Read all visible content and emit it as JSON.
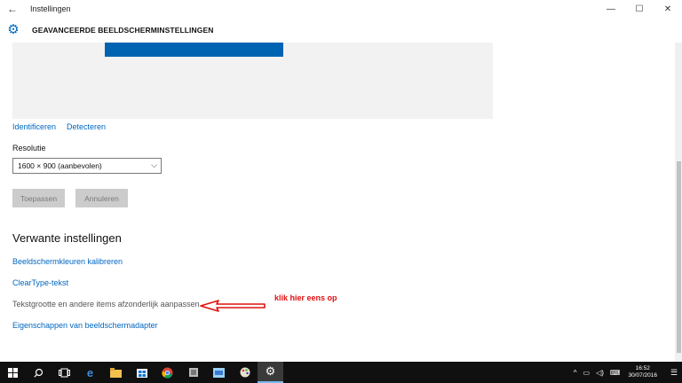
{
  "window": {
    "app_title": "Instellingen",
    "back_icon": "←",
    "controls": [
      "—",
      "☐",
      "✕"
    ]
  },
  "header": {
    "icon": "gear-icon",
    "title": "GEAVANCEERDE BEELDSCHERMINSTELLINGEN"
  },
  "display": {
    "identify_label": "Identificeren",
    "detect_label": "Detecteren",
    "resolution_label": "Resolutie",
    "resolution_value": "1600 × 900 (aanbevolen)",
    "apply_label": "Toepassen",
    "cancel_label": "Annuleren"
  },
  "related": {
    "title": "Verwante instellingen",
    "items": [
      "Beeldschermkleuren kalibreren",
      "ClearType-tekst",
      "Tekstgrootte en andere items afzonderlijk aanpassen",
      "Eigenschappen van beeldschermadapter"
    ]
  },
  "annotation": {
    "text": "klik  hier eens op",
    "color": "#e01010"
  },
  "colors": {
    "accent": "#0067c0",
    "monitor_blue": "#0063b1",
    "taskbar": "#101010"
  },
  "taskbar": {
    "apps": [
      "windows-logo",
      "search-icon",
      "task-view-icon",
      "edge-icon",
      "file-explorer-icon",
      "store-icon",
      "chrome-icon",
      "app-icon",
      "app-icon-2",
      "paint-icon",
      "settings-icon"
    ],
    "tray": {
      "time": "16:52",
      "date": "30/07/2016"
    }
  }
}
